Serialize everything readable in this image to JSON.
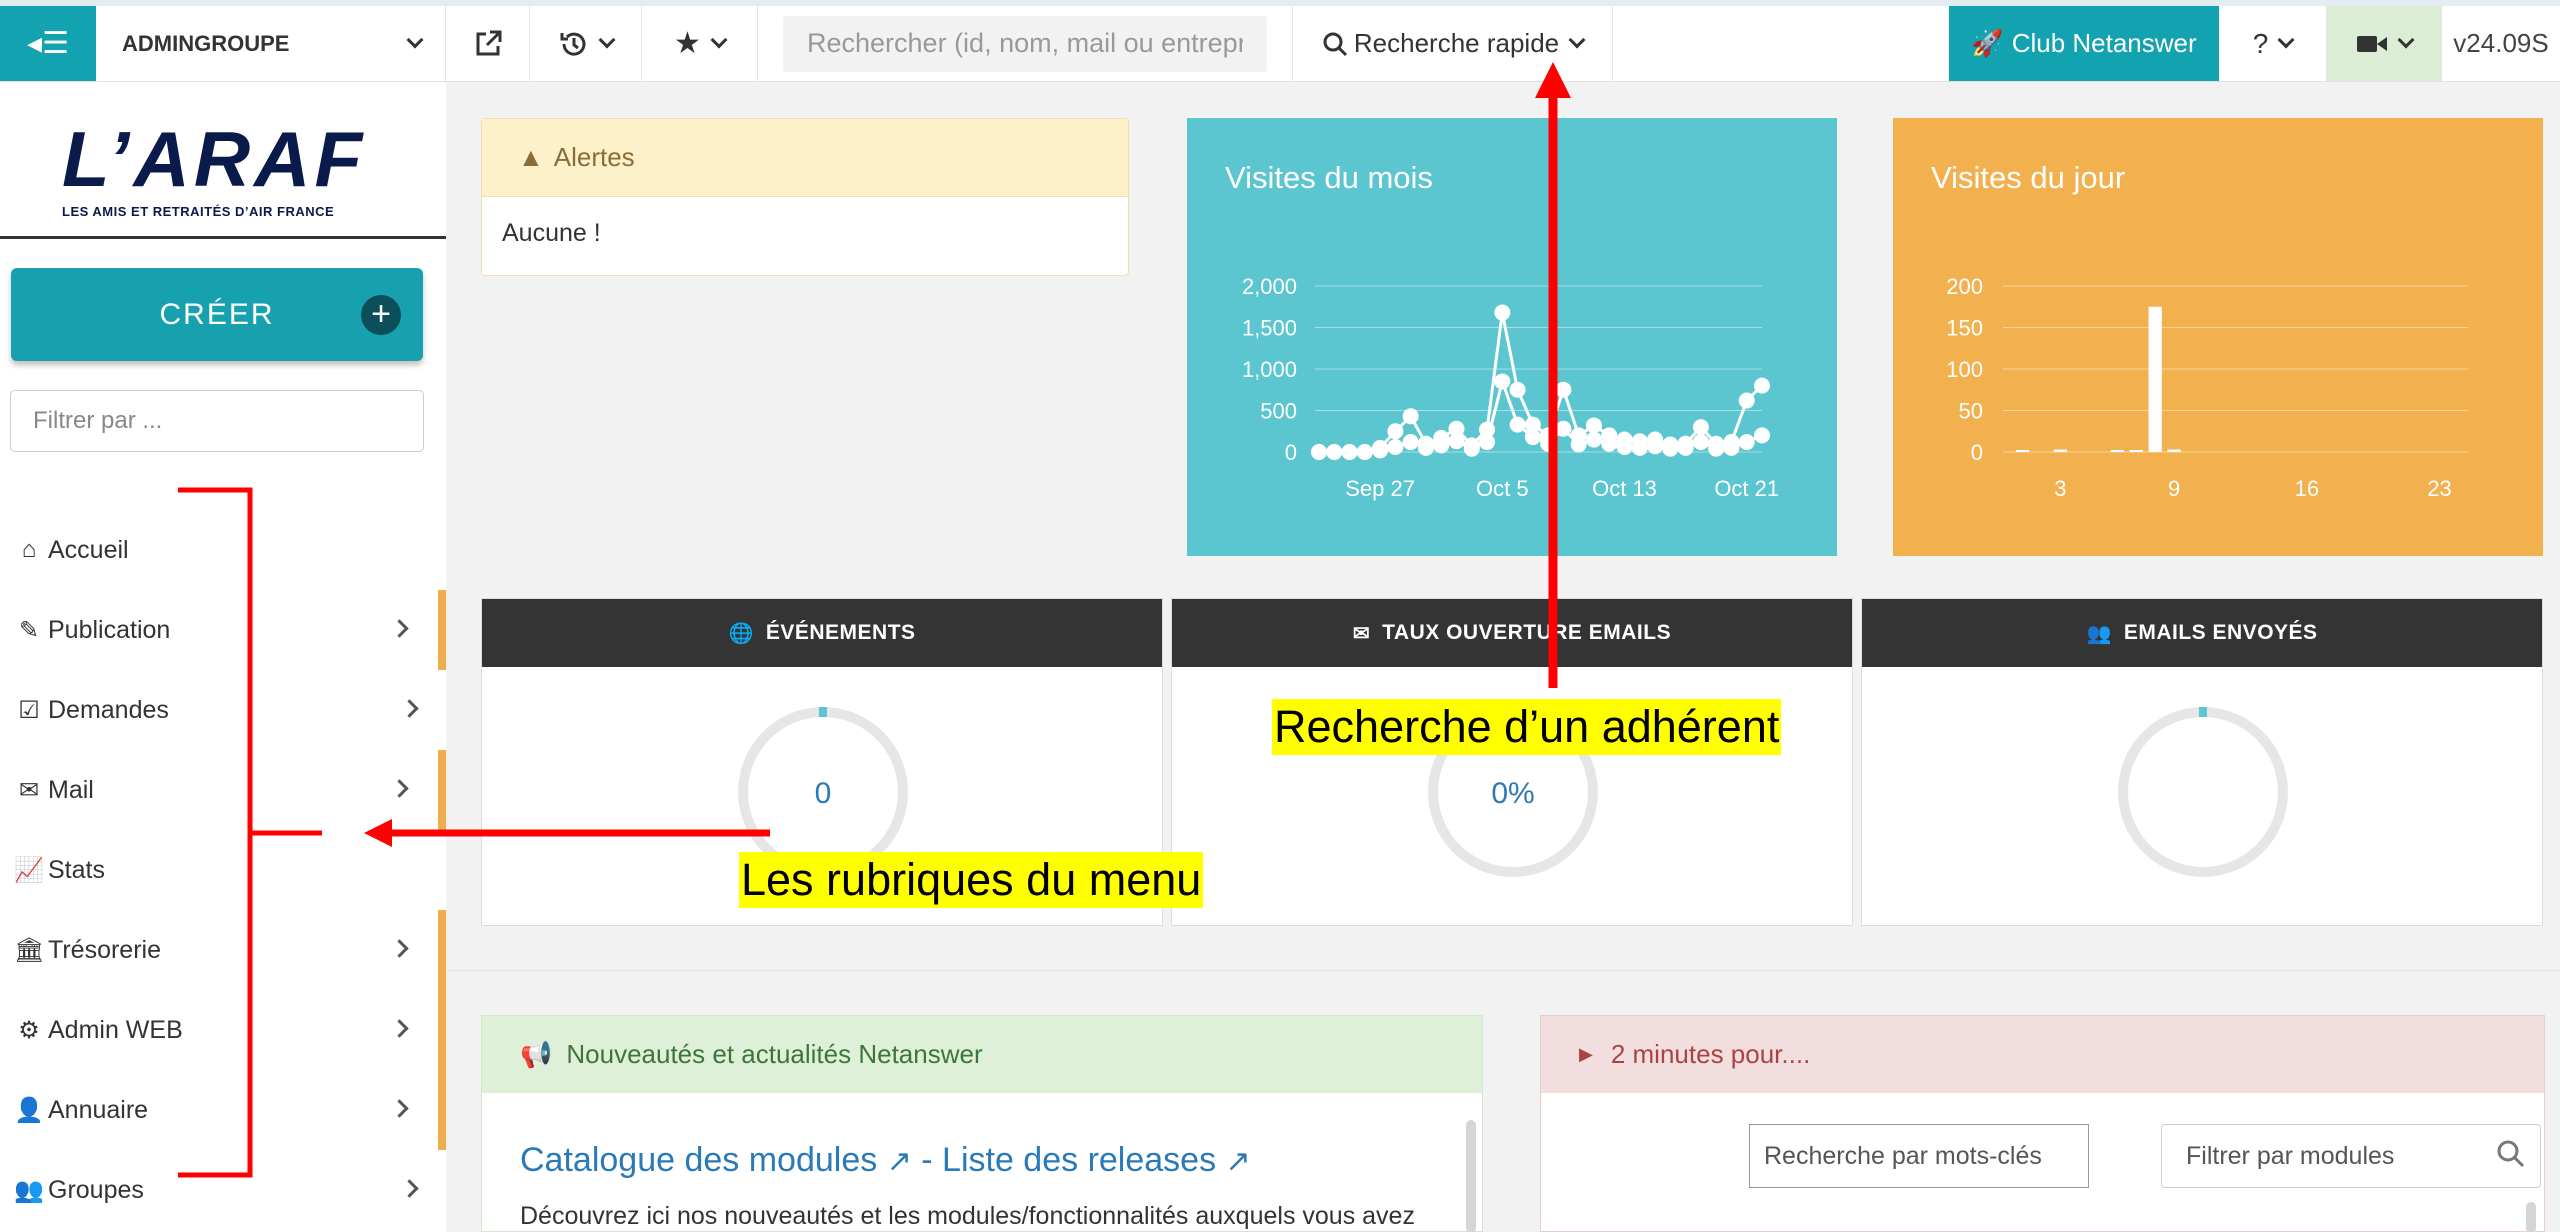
{
  "topbar": {
    "group_name": "ADMINGROUPE",
    "search_placeholder": "Rechercher (id, nom, mail ou entrepris",
    "quick_search_label": "Recherche rapide",
    "club_label": "Club Netanswer",
    "help_label": "?",
    "version": "v24.09S",
    "accent_color": "#13a3b0"
  },
  "sidebar": {
    "logo_text": "L’ARAF",
    "logo_subtitle": "LES AMIS ET RETRAITÉS D’AIR FRANCE",
    "create_label": "CRÉER",
    "filter_placeholder": "Filtrer par ...",
    "items": [
      {
        "label": "Accueil",
        "icon": "home-icon",
        "has_submenu": false
      },
      {
        "label": "Publication",
        "icon": "edit-icon",
        "has_submenu": true
      },
      {
        "label": "Demandes",
        "icon": "check-square-icon",
        "has_submenu": true
      },
      {
        "label": "Mail",
        "icon": "envelope-icon",
        "has_submenu": true
      },
      {
        "label": "Stats",
        "icon": "line-chart-icon",
        "has_submenu": false
      },
      {
        "label": "Trésorerie",
        "icon": "bank-icon",
        "has_submenu": true
      },
      {
        "label": "Admin WEB",
        "icon": "gear-icon",
        "has_submenu": true
      },
      {
        "label": "Annuaire",
        "icon": "user-icon",
        "has_submenu": true
      },
      {
        "label": "Groupes",
        "icon": "users-icon",
        "has_submenu": true
      }
    ]
  },
  "alerts": {
    "title": "Alertes",
    "body": "Aucune !"
  },
  "visits_month": {
    "title": "Visites du mois",
    "color": "#5bc5d0"
  },
  "visits_day": {
    "title": "Visites du jour",
    "color": "#f2b04f"
  },
  "chart_data": [
    {
      "type": "line",
      "title": "Visites du mois",
      "xlabel": "",
      "ylabel": "",
      "y_ticks": [
        "2,000",
        "1,500",
        "1,000",
        "500",
        "0"
      ],
      "ylim": [
        0,
        2000
      ],
      "x_ticks": [
        "Sep 27",
        "Oct 5",
        "Oct 13",
        "Oct 21"
      ],
      "x": [
        "Sep 23",
        "Sep 24",
        "Sep 25",
        "Sep 26",
        "Sep 27",
        "Sep 28",
        "Sep 29",
        "Sep 30",
        "Oct 1",
        "Oct 2",
        "Oct 3",
        "Oct 4",
        "Oct 5",
        "Oct 6",
        "Oct 7",
        "Oct 8",
        "Oct 9",
        "Oct 10",
        "Oct 11",
        "Oct 12",
        "Oct 13",
        "Oct 14",
        "Oct 15",
        "Oct 16",
        "Oct 17",
        "Oct 18",
        "Oct 19",
        "Oct 20",
        "Oct 21",
        "Oct 22"
      ],
      "series": [
        {
          "values": [
            0,
            0,
            0,
            0,
            50,
            250,
            430,
            100,
            170,
            280,
            80,
            270,
            1680,
            750,
            330,
            200,
            750,
            200,
            320,
            200,
            150,
            130,
            150,
            90,
            100,
            300,
            100,
            120,
            620,
            800
          ]
        },
        {
          "values": [
            0,
            0,
            0,
            0,
            20,
            60,
            120,
            50,
            80,
            130,
            40,
            120,
            850,
            330,
            180,
            100,
            280,
            90,
            150,
            100,
            60,
            50,
            70,
            40,
            50,
            120,
            40,
            50,
            120,
            200
          ]
        }
      ],
      "grid": true
    },
    {
      "type": "bar",
      "title": "Visites du jour",
      "xlabel": "",
      "ylabel": "",
      "y_ticks": [
        "200",
        "150",
        "100",
        "50",
        "0"
      ],
      "ylim": [
        0,
        200
      ],
      "x_ticks": [
        "3",
        "9",
        "16",
        "23"
      ],
      "x": [
        1,
        2,
        3,
        4,
        5,
        6,
        7,
        8,
        9,
        10,
        11,
        12,
        13,
        14,
        15,
        16,
        17,
        18,
        19,
        20,
        21,
        22,
        23,
        24
      ],
      "values": [
        1,
        0,
        3,
        0,
        0,
        1,
        2,
        175,
        3,
        0,
        0,
        0,
        0,
        0,
        0,
        0,
        0,
        0,
        0,
        0,
        0,
        0,
        0,
        0
      ],
      "grid": true
    }
  ],
  "stats": [
    {
      "title": "ÉVÉNEMENTS",
      "icon": "globe-icon",
      "value": "0",
      "fraction": 0.0
    },
    {
      "title": "TAUX OUVERTURE EMAILS",
      "icon": "envelope-icon",
      "value": "0%",
      "fraction": 0.0
    },
    {
      "title": "EMAILS ENVOYÉS",
      "icon": "users-icon",
      "value": "",
      "fraction": 0.0
    }
  ],
  "news": {
    "title": "Nouveautés et actualités Netanswer",
    "link1": "Catalogue des modules",
    "separator": " - ",
    "link2": "Liste des releases",
    "description": "Découvrez ici nos nouveautés et les modules/fonctionnalités auxquels vous avez"
  },
  "two_minutes": {
    "title": "2 minutes pour....",
    "keyword_placeholder": "Recherche par mots-clés",
    "module_filter": "Filtrer par modules"
  },
  "annotations": {
    "search_callout": "Recherche d’un adhérent",
    "menu_callout": "Les rubriques du menu",
    "arrow_color": "#ff0000",
    "highlight_color": "#ffff00"
  }
}
